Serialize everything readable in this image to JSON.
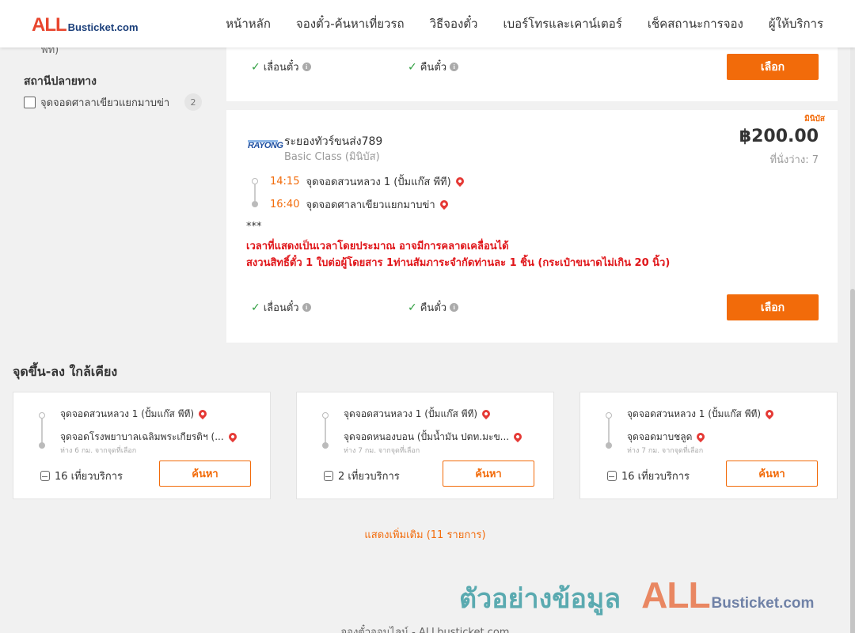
{
  "header": {
    "logo_all": "ALL",
    "logo_rest": "Busticket.com",
    "nav": [
      "หน้าหลัก",
      "จองตั๋ว-ค้นหาเที่ยวรถ",
      "วิธีจองตั๋ว",
      "เบอร์โทรและเคาน์เตอร์",
      "เช็คสถานะการจอง",
      "ผู้ให้บริการ"
    ]
  },
  "sidebar": {
    "cut_text": "พีที)",
    "dest_title": "สถานีปลายทาง",
    "dest_filter": {
      "label": "จุดจอดศาลาเขียวแยกมาบข่า",
      "count": "2"
    }
  },
  "trip_prev": {
    "feature_1": "เลื่อนตั๋ว",
    "feature_2": "คืนตั๋ว",
    "select_label": "เลือก"
  },
  "trip": {
    "tag": "มินิบัส",
    "operator_logo": "RAYONG",
    "operator_name": "ระยองทัวร์ขนส่ง789",
    "class": "Basic Class (มินิบัส)",
    "price": "฿200.00",
    "seats": "ที่นั่งว่าง: 7",
    "depart_time": "14:15",
    "depart_stop": "จุดจอดสวนหลวง 1 (ปั้มแก๊ส พีที)",
    "arrive_time": "16:40",
    "arrive_stop": "จุดจอดศาลาเขียวแยกมาบข่า",
    "note_stars": "***",
    "note_1": "เวลาที่แสดงเป็นเวลาโดยประมาณ อาจมีการคลาดเคลื่อนได้",
    "note_2": "สงวนสิทธิ์ตั๋ว 1 ใบต่อผู้โดยสาร 1ท่านสัมภาระจำกัดท่านละ 1 ชิ้น (กระเป๋าขนาดไม่เกิน 20 นิ้ว)",
    "feature_1": "เลื่อนตั๋ว",
    "feature_2": "คืนตั๋ว",
    "select_label": "เลือก"
  },
  "nearby": {
    "title": "จุดขึ้น-ลง ใกล้เคียง",
    "cards": [
      {
        "from": "จุดจอดสวนหลวง 1 (ปั้มแก๊ส พีที)",
        "to": "จุดจอดโรงพยาบาลเฉลิมพระเกียรติฯ (...",
        "dist": "ห่าง 6 กม. จากจุดที่เลือก",
        "trips": "16 เที่ยวบริการ",
        "button": "ค้นหา"
      },
      {
        "from": "จุดจอดสวนหลวง 1 (ปั้มแก๊ส พีที)",
        "to": "จุดจอดหนองบอน (ปั้มน้ำมัน ปตท.มะข...",
        "dist": "ห่าง 7 กม. จากจุดที่เลือก",
        "trips": "2 เที่ยวบริการ",
        "button": "ค้นหา"
      },
      {
        "from": "จุดจอดสวนหลวง 1 (ปั้มแก๊ส พีที)",
        "to": "จุดจอดมาบชลูด",
        "dist": "ห่าง 7 กม. จากจุดที่เลือก",
        "trips": "16 เที่ยวบริการ",
        "button": "ค้นหา"
      }
    ],
    "show_more": "แสดงเพิ่มเติม (11 รายการ)"
  },
  "watermark": {
    "th": "ตัวอย่างข้อมูล",
    "all": "ALL",
    "rest": "Busticket.com"
  },
  "footer_cut": "จองตั๋วออนไลน์ - ALLbusticket.com",
  "colors": {
    "accent": "#f26b0a",
    "warning": "#e0161a",
    "check": "#2e9e3f"
  }
}
